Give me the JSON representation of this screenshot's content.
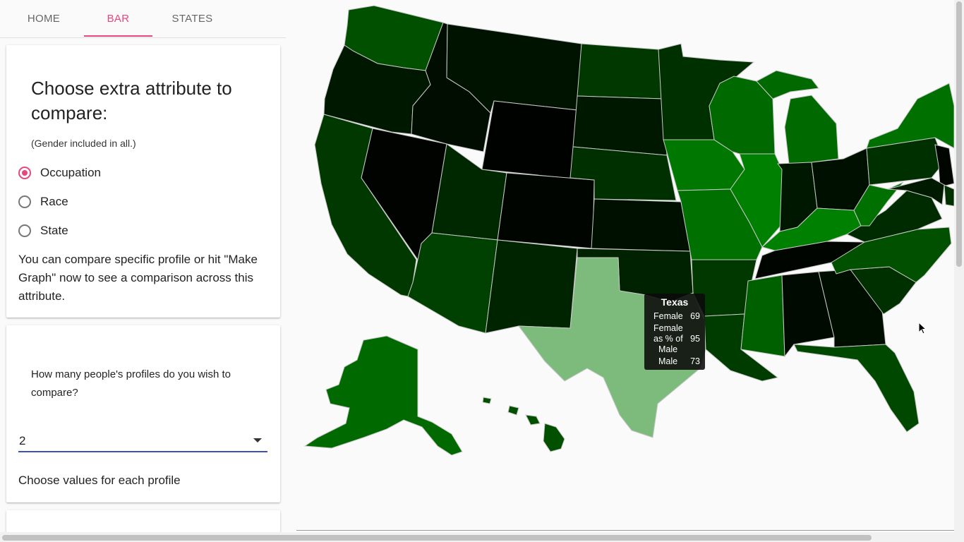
{
  "tabs": [
    {
      "label": "HOME",
      "active": false
    },
    {
      "label": "BAR",
      "active": true
    },
    {
      "label": "STATES",
      "active": false
    }
  ],
  "compare_card": {
    "title": "Choose extra attribute to compare:",
    "subtitle": "(Gender included in all.)",
    "options": [
      {
        "label": "Occupation",
        "selected": true
      },
      {
        "label": "Race",
        "selected": false
      },
      {
        "label": "State",
        "selected": false
      }
    ],
    "help": "You can compare specific profile or hit \"Make Graph\" now to see a comparison across this attribute."
  },
  "profiles_card": {
    "question": "How many people's profiles do you wish to compare?",
    "count_value": "2",
    "choose_values": "Choose values for each profile"
  },
  "map": {
    "highlight_color": "#7dbb7d",
    "tooltip": {
      "state": "Texas",
      "female_label": "Female",
      "female_value": "69",
      "pct_label_1": "Female",
      "pct_label_2": "as % of",
      "pct_label_3": "Male",
      "pct_value": "95",
      "male_label": "Male",
      "male_value": "73"
    }
  },
  "colors": {
    "accent": "#e8467c",
    "select_underline": "#3f51b5"
  }
}
